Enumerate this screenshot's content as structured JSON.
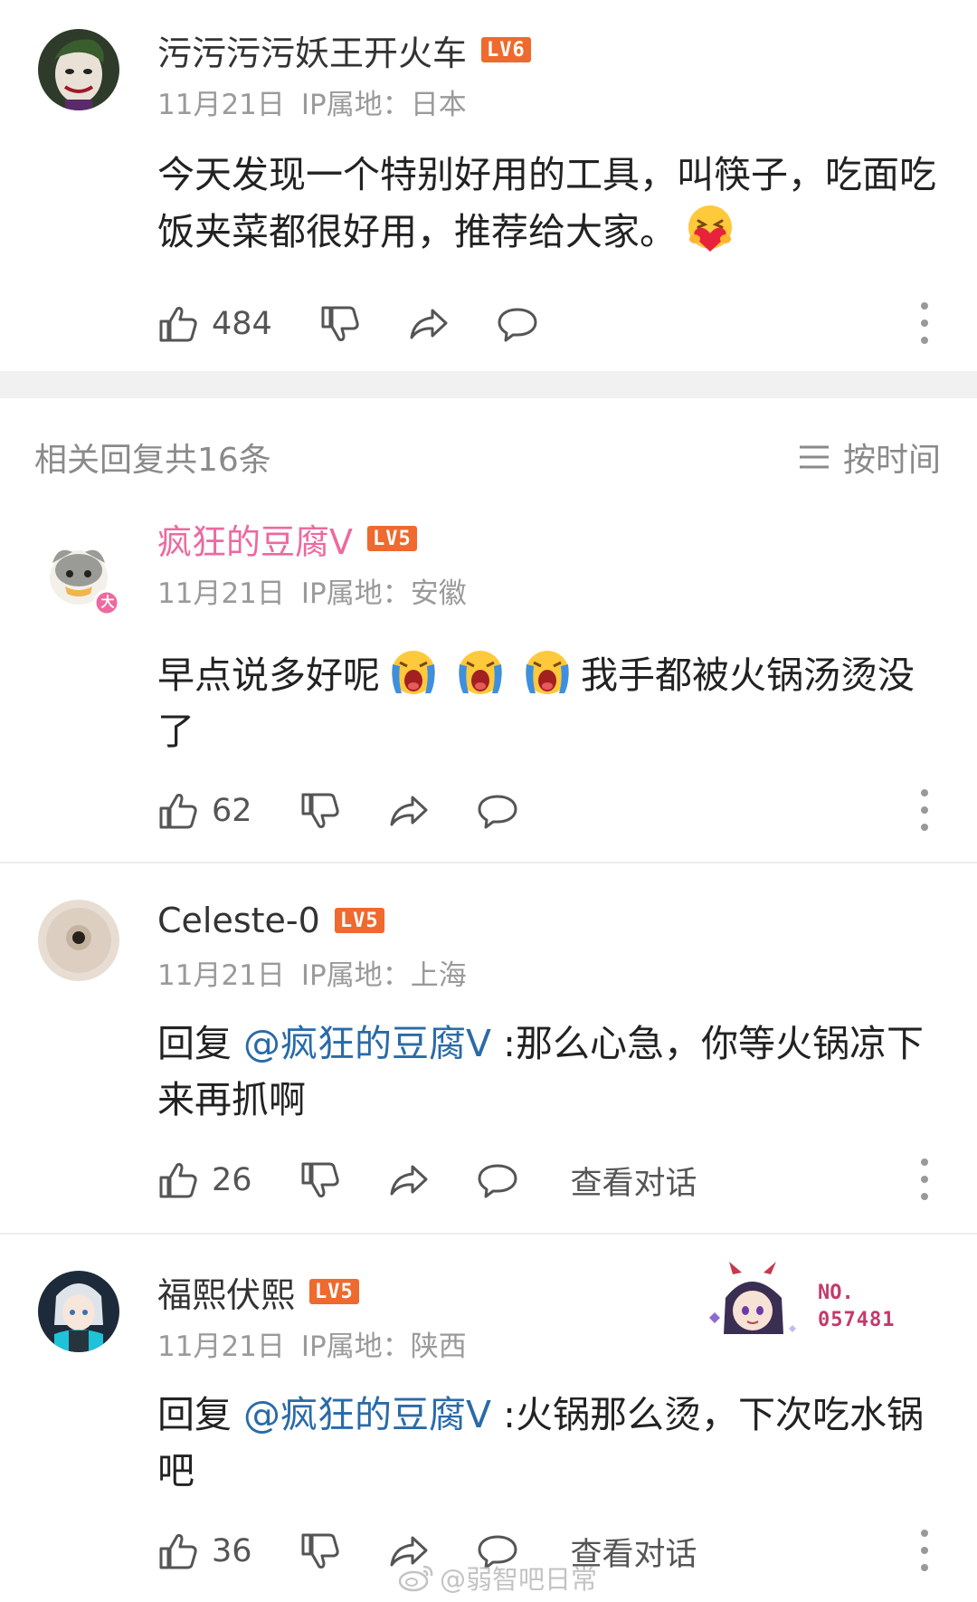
{
  "main_comment": {
    "author": "污污污污妖王开火车",
    "level": "LV6",
    "date": "11月21日",
    "ip": "IP属地：日本",
    "text_before": "今天发现一个特别好用的工具，叫筷子，吃面吃饭夹菜都很好用，推荐给大家。",
    "likes": "484",
    "emoji": "heart-hug-emoji"
  },
  "replies_header": {
    "title": "相关回复共16条",
    "sort_label": "按时间"
  },
  "replies": [
    {
      "author": "疯狂的豆腐V",
      "level": "LV5",
      "date": "11月21日",
      "ip": "IP属地：安徽",
      "text_before": "早点说多好呢",
      "text_after": "我手都被火锅汤烫没了",
      "likes": "62",
      "badge": "大"
    },
    {
      "author": "Celeste-0",
      "level": "LV5",
      "date": "11月21日",
      "ip": "IP属地：上海",
      "reply_prefix": "回复 ",
      "mention": "@疯狂的豆腐V",
      "text": " :那么心急，你等火锅凉下来再抓啊",
      "likes": "26",
      "view_conversation": "查看对话"
    },
    {
      "author": "福熙伏熙",
      "level": "LV5",
      "date": "11月21日",
      "ip": "IP属地：陕西",
      "reply_prefix": "回复 ",
      "mention": "@疯狂的豆腐V",
      "text": " :火锅那么烫，下次吃水锅吧",
      "likes": "36",
      "view_conversation": "查看对话",
      "decor_badge_label": "NO.",
      "decor_badge_number": "057481"
    }
  ],
  "watermark": "@弱智吧日常",
  "colors": {
    "accent_pink": "#ec6a9f",
    "level_orange": "#ee6a2e",
    "mention_blue": "#2a6aa8",
    "meta_gray": "#9a9a9a"
  }
}
